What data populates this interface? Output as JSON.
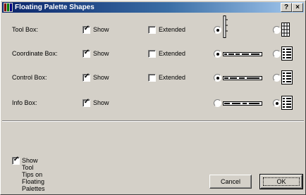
{
  "window": {
    "title": "Floating Palette Shapes",
    "help_label": "?",
    "close_label": "×"
  },
  "rows": [
    {
      "label": "Tool Box:",
      "show_label": "Show",
      "show_checked": true,
      "extended_label": "Extended",
      "extended_checked": false,
      "selected": 0,
      "has_extended": true
    },
    {
      "label": "Coordinate Box:",
      "show_label": "Show",
      "show_checked": true,
      "extended_label": "Extended",
      "extended_checked": false,
      "selected": 0,
      "has_extended": true
    },
    {
      "label": "Control Box:",
      "show_label": "Show",
      "show_checked": true,
      "extended_label": "Extended",
      "extended_checked": false,
      "selected": 0,
      "has_extended": true
    },
    {
      "label": "Info Box:",
      "show_label": "Show",
      "show_checked": true,
      "selected": 1,
      "has_extended": false
    }
  ],
  "footer": {
    "tooltips_label": "Show Tool Tips on Floating Palettes",
    "tooltips_checked": true,
    "cancel_label": "Cancel",
    "ok_label": "OK"
  },
  "icons": {
    "window": "palette-icon",
    "check": "checkmark",
    "vertical_palette": "vertical-palette-icon",
    "horizontal_palette": "horizontal-palette-icon",
    "grid_palette": "grid-palette-icon",
    "list_palette": "list-palette-icon"
  }
}
